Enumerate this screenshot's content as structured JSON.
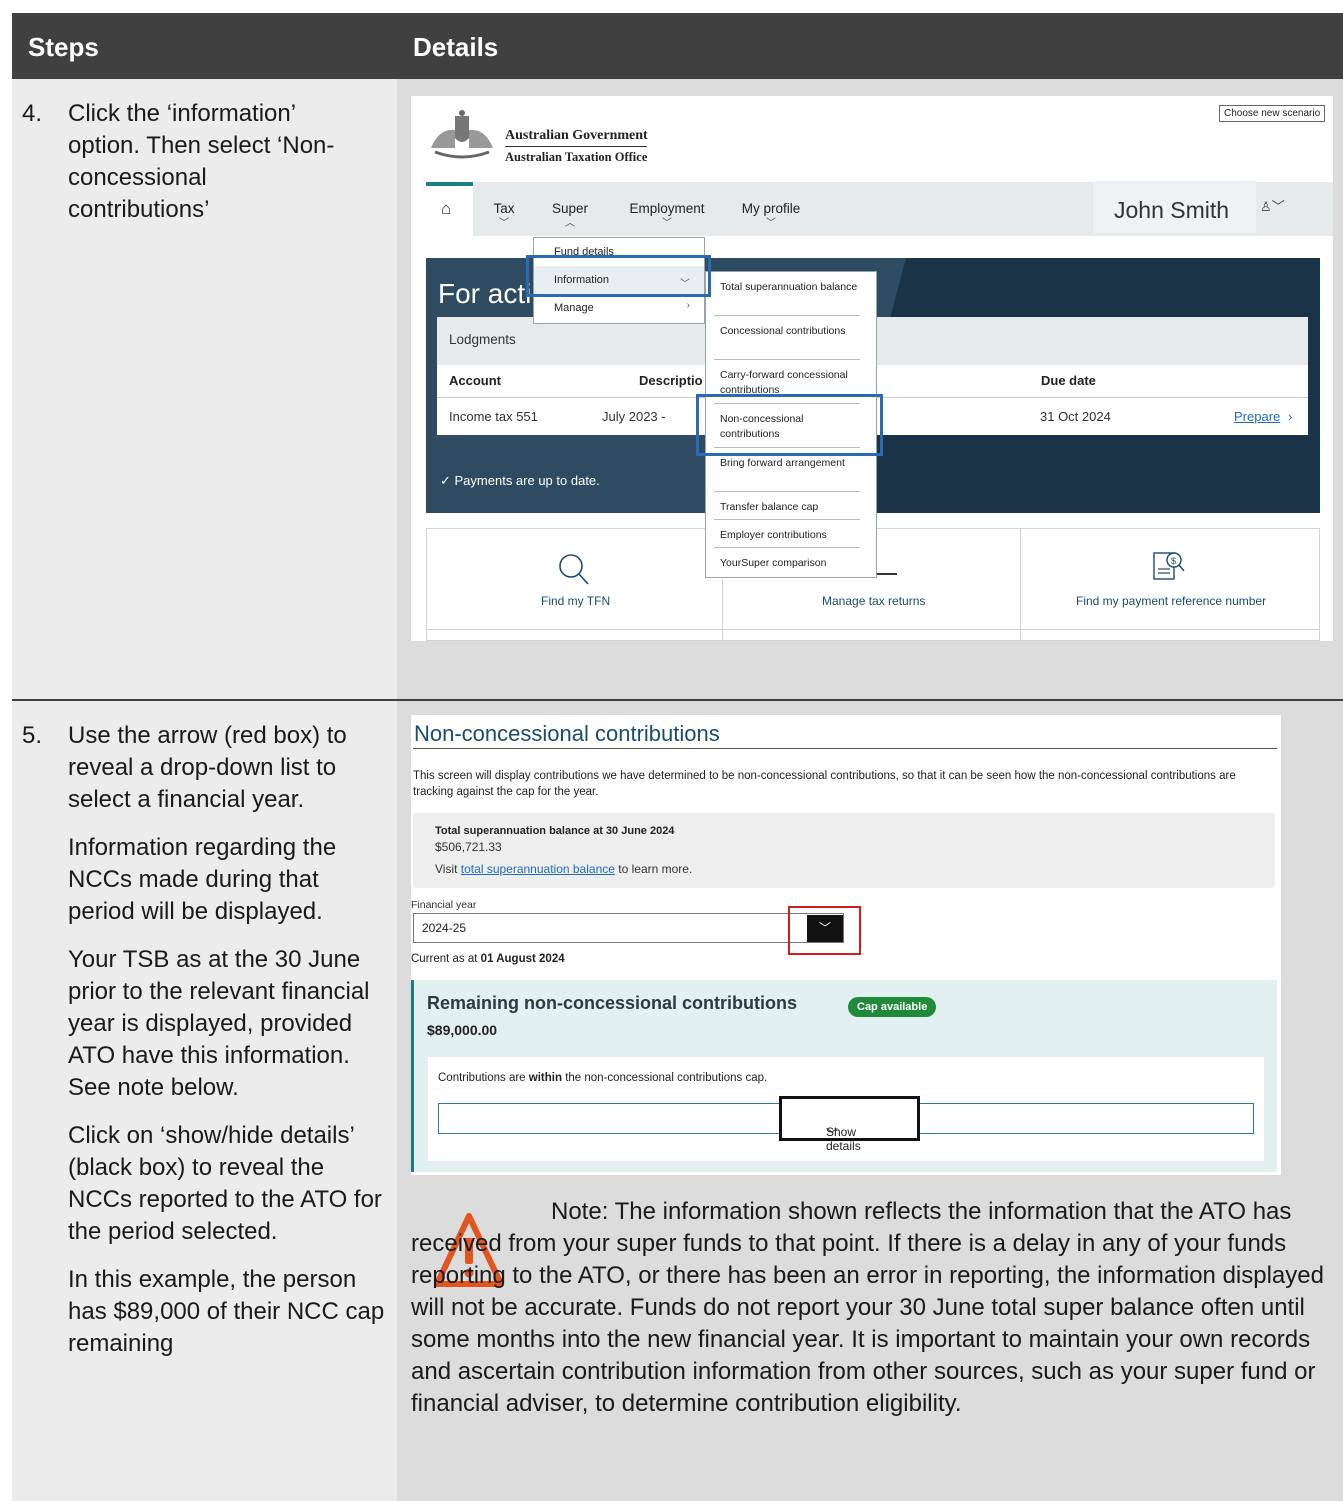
{
  "header": {
    "steps": "Steps",
    "details": "Details"
  },
  "step4": {
    "num": "4.",
    "text": "Click the ‘information’ option. Then select ‘Non-concessional contributions’"
  },
  "step5": {
    "num": "5.",
    "p1": "Use the arrow (red box) to reveal a drop-down list to select a financial year.",
    "p2": "Information regarding the NCCs made during that period will be displayed.",
    "p3": "Your TSB as at the 30 June prior to the relevant financial year is displayed, provided ATO have this information. See note below.",
    "p4": "Click on ‘show/hide details’ (black box) to reveal the NCCs reported to the ATO for the period selected.",
    "p5": "In this example, the person has $89,000 of their NCC cap remaining"
  },
  "ato": {
    "gov_line1": "Australian Government",
    "gov_line2": "Australian Taxation Office",
    "choose_scenario": "Choose new scenario",
    "nav": [
      "Tax",
      "Super",
      "Employment",
      "My profile"
    ],
    "user_name": "John Smith",
    "hero_title": "For acti",
    "lodgments": "Lodgments",
    "table_headers": {
      "account": "Account",
      "description": "Descriptio",
      "due": "Due date"
    },
    "row": {
      "account": "Income tax 551",
      "description": "July 2023 -",
      "due": "31 Oct 2024",
      "action": "Prepare"
    },
    "payments": "Payments are up to date.",
    "tiles": [
      "Find my TFN",
      "Manage tax returns",
      "Find my payment reference number"
    ],
    "super_menu": [
      "Fund details",
      "Information",
      "Manage"
    ],
    "info_menu": [
      "Total superannuation balance",
      "Concessional contributions",
      "Carry-forward concessional contributions",
      "Non-concessional contributions",
      "Bring forward arrangement",
      "Transfer balance cap",
      "Employer contributions",
      "YourSuper comparison"
    ]
  },
  "ncc": {
    "title": "Non-concessional contributions",
    "intro": "This screen will display contributions we have determined to be non-concessional contributions, so that it can be seen how the non-concessional contributions are tracking against the cap for the year.",
    "tsb_title": "Total superannuation balance at 30 June 2024",
    "tsb_value": "$506,721.33",
    "visit_pre": "Visit ",
    "visit_link": "total superannuation balance",
    "visit_post": " to learn more.",
    "fy_label": "Financial year",
    "fy_value": "2024-25",
    "current_pre": "Current as at ",
    "current_date": "01 August 2024",
    "remaining_title": "Remaining non-concessional contributions",
    "badge": "Cap available",
    "remaining_value": "$89,000.00",
    "within_pre": "Contributions are ",
    "within_bold": "within",
    "within_post": " the non-concessional contributions cap.",
    "show_details": "Show details"
  },
  "note": "Note: The information shown reflects the information that the ATO has received from your super funds to that point. If there is a delay in any of your funds reporting to the ATO, or there has been an error in reporting, the information displayed will not be accurate. Funds do not report your 30 June total super balance often until some months into the new financial year. It is important to maintain your own records and ascertain contribution information from other sources, such as your super fund or financial adviser, to determine contribution eligibility.",
  "colors": {
    "header_bg": "#404040",
    "left_bg": "#ececec",
    "right_bg": "#dcdcdc",
    "teal": "#1b7f80",
    "blue_box": "#2b6bb3",
    "red_box": "#d21d1d",
    "badge_green": "#1f8a3a"
  }
}
